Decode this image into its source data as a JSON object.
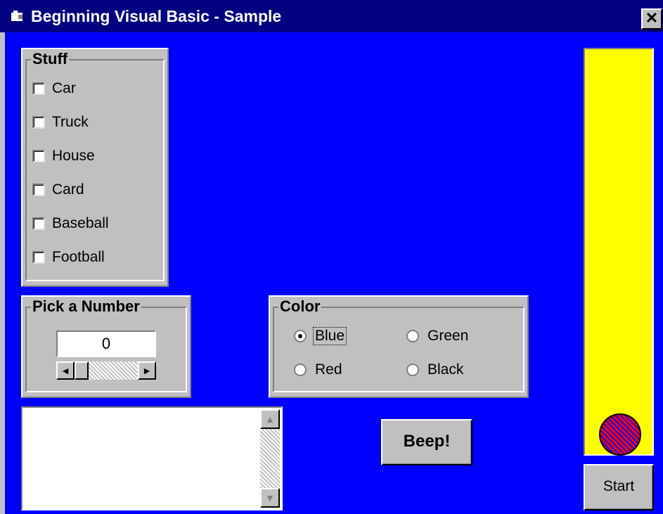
{
  "window": {
    "title": "Beginning Visual Basic - Sample",
    "close_label": "✕"
  },
  "stuff": {
    "legend": "Stuff",
    "items": [
      {
        "label": "Car",
        "checked": false
      },
      {
        "label": "Truck",
        "checked": false
      },
      {
        "label": "House",
        "checked": false
      },
      {
        "label": "Card",
        "checked": false
      },
      {
        "label": "Baseball",
        "checked": false
      },
      {
        "label": "Football",
        "checked": false
      }
    ]
  },
  "pick_number": {
    "legend": "Pick a Number",
    "value": "0",
    "left_arrow": "◄",
    "right_arrow": "►"
  },
  "color": {
    "legend": "Color",
    "options": [
      {
        "label": "Blue",
        "selected": true
      },
      {
        "label": "Green",
        "selected": false
      },
      {
        "label": "Red",
        "selected": false
      },
      {
        "label": "Black",
        "selected": false
      }
    ]
  },
  "textbox": {
    "value": "",
    "up_arrow": "▲",
    "down_arrow": "▼"
  },
  "buttons": {
    "beep_label": "Beep!",
    "start_label": "Start"
  },
  "colors": {
    "form_background": "#0000ff",
    "title_bar": "#000080",
    "picture_background": "#ffff00",
    "ball_fill": "#ff0000",
    "ball_hatch": "#0000ff"
  }
}
